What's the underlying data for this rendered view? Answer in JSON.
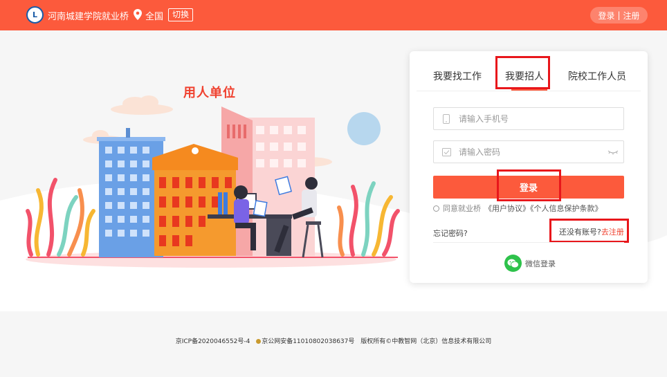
{
  "header": {
    "site_name": "河南城建学院就业桥",
    "location": "全国",
    "switch_label": "切换",
    "login_label": "登录",
    "separator": "|",
    "register_label": "注册"
  },
  "illustration": {
    "title": "用人单位"
  },
  "login_card": {
    "tabs": [
      {
        "label": "我要找工作"
      },
      {
        "label": "我要招人"
      },
      {
        "label": "院校工作人员"
      }
    ],
    "phone_placeholder": "请输入手机号",
    "password_placeholder": "请输入密码",
    "login_button": "登录",
    "agree_prefix": "同意就业桥",
    "agree_links": "《用户协议》《个人信息保护条款》",
    "forgot_password": "忘记密码?",
    "no_account": "还没有账号?",
    "go_register": "去注册",
    "wechat_login": "微信登录"
  },
  "footer": {
    "icp": "京ICP备2020046552号-4",
    "police": "京公网安备11010802038637号",
    "copyright": "版权所有©中教智网（北京）信息技术有限公司"
  },
  "colors": {
    "brand": "#fc5a3c",
    "highlight_box": "#e8161b",
    "wechat": "#2ec24b"
  }
}
